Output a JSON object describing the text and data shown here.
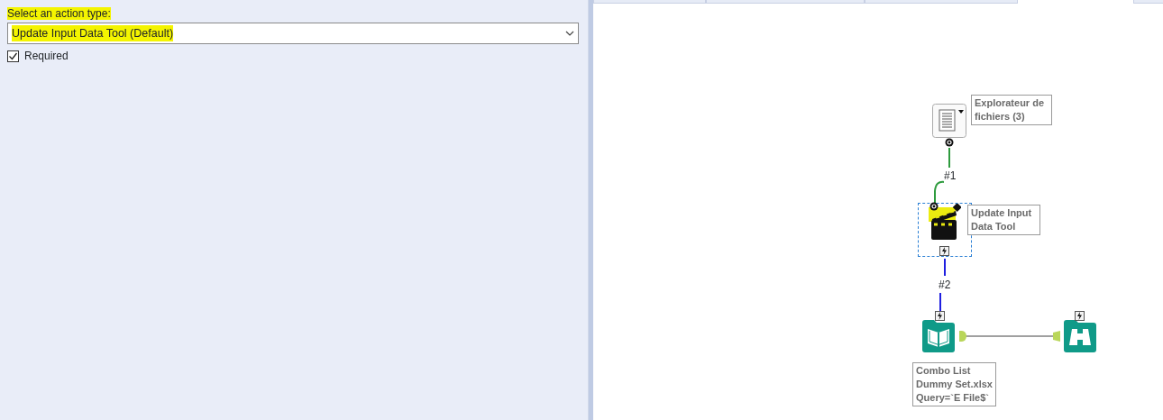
{
  "config_panel": {
    "label": {
      "text": "Select an action type:",
      "highlighted": true
    },
    "dropdown": {
      "value": "Update Input Data Tool (Default)",
      "highlighted": true
    },
    "required": {
      "label": "Required",
      "checked": true
    }
  },
  "canvas": {
    "nodes": [
      {
        "kind": "directory",
        "label_lines": [
          "Explorateur de",
          "fichiers (3)"
        ],
        "selected": false
      },
      {
        "kind": "action",
        "label_lines": [
          "Update Input",
          "Data Tool"
        ],
        "selected": true
      },
      {
        "kind": "input",
        "label_lines": [
          "Combo List",
          "Dummy Set.xlsx",
          "Query=`E File$`"
        ],
        "selected": false
      },
      {
        "kind": "browse",
        "selected": false
      }
    ],
    "connections": [
      {
        "label": "#1",
        "color": "#2e9b3e"
      },
      {
        "label": "#2",
        "color": "#1f1fe0"
      },
      {
        "color": "#a0a0a0"
      }
    ]
  }
}
